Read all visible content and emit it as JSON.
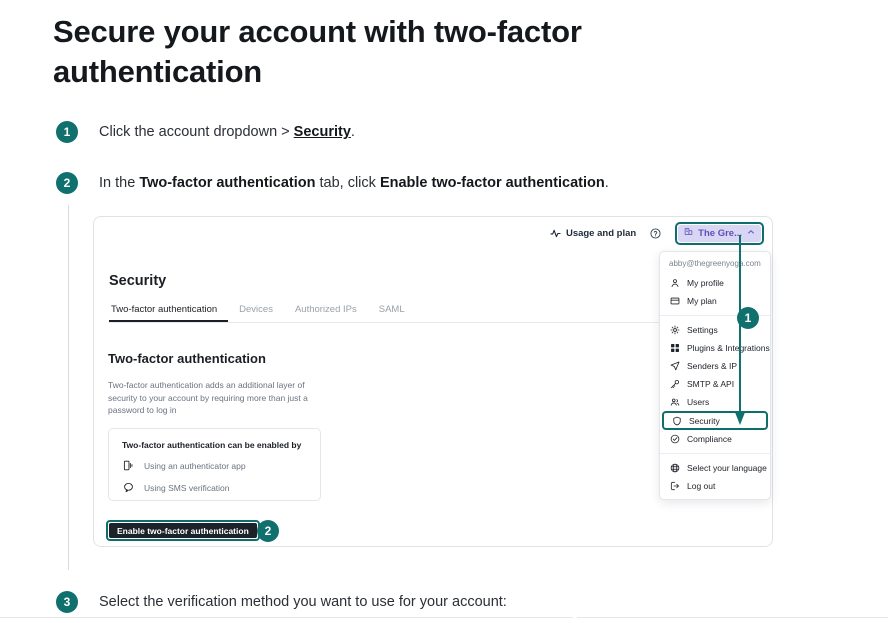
{
  "article": {
    "title": "Secure your account with two-factor authentication",
    "steps": [
      {
        "number": "1",
        "prefix": "Click the account dropdown > ",
        "link": "Security",
        "suffix": "."
      },
      {
        "number": "2",
        "prefix": "In the ",
        "bold1": "Two-factor authentication",
        "middle": " tab, click ",
        "bold2": "Enable two-factor authentication",
        "suffix": "."
      },
      {
        "number": "3",
        "prefix": "Select the verification method you want to use for your account:"
      }
    ]
  },
  "screenshot": {
    "topbar": {
      "usage_icon": "activity-pulse-icon",
      "usage_label": "Usage and plan",
      "help_icon": "help-circle-icon",
      "account_icon": "building-icon",
      "account_label": "The Gre...",
      "account_chevron": "chevron-up-icon"
    },
    "account_menu": {
      "email": "abby@thegreenyoga.com",
      "groups": [
        {
          "items": [
            {
              "icon": "user-icon",
              "label": "My profile"
            },
            {
              "icon": "card-icon",
              "label": "My plan"
            }
          ]
        },
        {
          "items": [
            {
              "icon": "gear-icon",
              "label": "Settings"
            },
            {
              "icon": "grid-icon",
              "label": "Plugins & Integrations"
            },
            {
              "icon": "send-icon",
              "label": "Senders & IP"
            },
            {
              "icon": "key-icon",
              "label": "SMTP & API"
            },
            {
              "icon": "users-icon",
              "label": "Users"
            },
            {
              "icon": "shield-icon",
              "label": "Security",
              "selected": true
            },
            {
              "icon": "check-circle-icon",
              "label": "Compliance"
            }
          ]
        },
        {
          "items": [
            {
              "icon": "globe-icon",
              "label": "Select your language"
            },
            {
              "icon": "logout-icon",
              "label": "Log out"
            }
          ]
        }
      ]
    },
    "security_page": {
      "title": "Security",
      "tabs": [
        {
          "label": "Two-factor authentication",
          "active": true
        },
        {
          "label": "Devices",
          "active": false
        },
        {
          "label": "Authorized IPs",
          "active": false
        },
        {
          "label": "SAML",
          "active": false
        }
      ],
      "section_heading": "Two-factor authentication",
      "section_description": "Two-factor authentication adds an additional layer of security to your account by requiring more than just a password to log in",
      "methods_box": {
        "title": "Two-factor authentication can be enabled by",
        "options": [
          {
            "icon": "authenticator-app-icon",
            "label": "Using an authenticator app"
          },
          {
            "icon": "sms-bubble-icon",
            "label": "Using SMS verification"
          }
        ]
      },
      "enable_button": "Enable two-factor authentication"
    },
    "callouts": [
      {
        "number": "1",
        "target": "Security"
      },
      {
        "number": "2",
        "target": "Enable two-factor authentication"
      }
    ]
  },
  "colors": {
    "accent_teal": "#10706e",
    "account_chip_bg": "#d9d5f4",
    "account_chip_text": "#5b52b8",
    "button_dark": "#1b2229"
  }
}
